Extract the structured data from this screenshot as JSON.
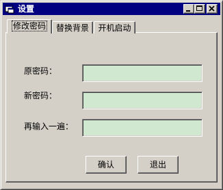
{
  "window": {
    "title": "设置",
    "caption_buttons": [
      "minimize",
      "maximize",
      "close"
    ]
  },
  "tabs": [
    {
      "label": "修改密码",
      "active": true
    },
    {
      "label": "替换背景",
      "active": false
    },
    {
      "label": "开机启动",
      "active": false
    }
  ],
  "form": {
    "old_password_label": "原密码：",
    "old_password_value": "",
    "new_password_label": "新密码：",
    "new_password_value": "",
    "confirm_password_label": "再输入一遍：",
    "confirm_password_value": ""
  },
  "buttons": {
    "ok_label": "确认",
    "exit_label": "退出"
  },
  "colors": {
    "titlebar": "#000080",
    "window_face": "#d4d0c8",
    "input_background": "#cfe8cf"
  }
}
